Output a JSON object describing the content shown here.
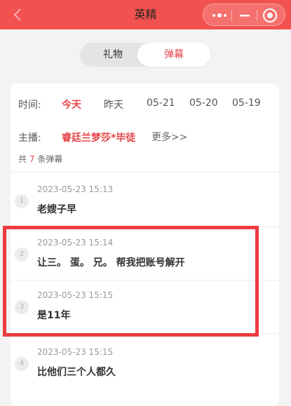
{
  "header": {
    "title": "英精",
    "back_icon": "chevron-left-icon",
    "menu_icon": "more-dots-icon",
    "minimize_icon": "minus-icon",
    "close_icon": "target-circle-icon"
  },
  "tabs": [
    {
      "label": "礼物",
      "active": false
    },
    {
      "label": "弹幕",
      "active": true
    }
  ],
  "filters": {
    "time_label": "时间:",
    "dates": [
      "今天",
      "昨天",
      "05-21",
      "05-20",
      "05-19"
    ],
    "active_date": "今天",
    "anchor_label": "主播:",
    "anchor_name": "睿廷兰梦莎*毕徒",
    "more_label": "更多>>"
  },
  "summary": {
    "prefix": "共",
    "count": "7",
    "suffix": "条弹幕"
  },
  "messages": [
    {
      "index": "1",
      "time": "2023-05-23 15:13",
      "text": "老嫂子早"
    },
    {
      "index": "2",
      "time": "2023-05-23 15:14",
      "text": "让三。 蛋。 兄。 帮我把账号解开"
    },
    {
      "index": "3",
      "time": "2023-05-23 15:15",
      "text": "是11年"
    },
    {
      "index": "4",
      "time": "2023-05-23 15:15",
      "text": "比他们三个人都久"
    }
  ],
  "colors": {
    "header_bg": "#f2524f",
    "accent": "#e2474a",
    "highlight": "#ee3b3f"
  }
}
